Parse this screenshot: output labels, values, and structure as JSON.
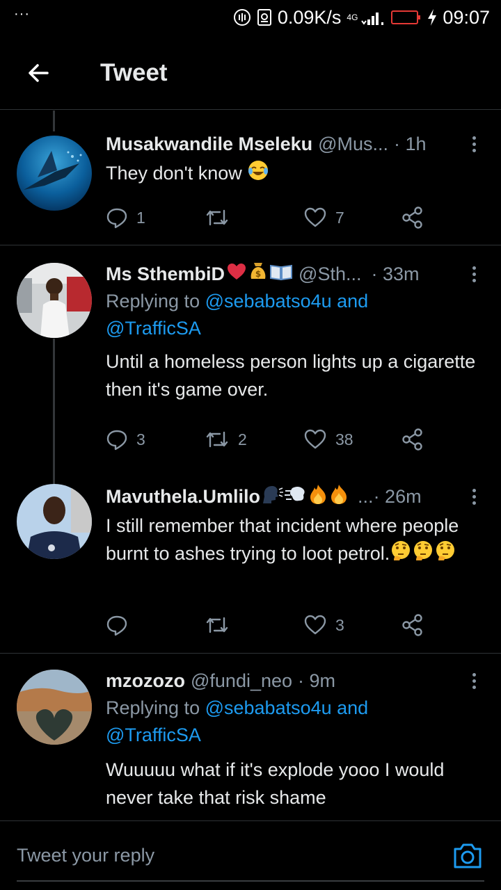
{
  "status_bar": {
    "left_dots": "···",
    "net_speed": "0.09K/s",
    "net_type": "4G",
    "time": "09:07"
  },
  "top_bar": {
    "title": "Tweet"
  },
  "tweets": [
    {
      "name": "Musakwandile Mseleku",
      "handle": "@Mus...",
      "time": "· 1h",
      "replying": null,
      "text": "They don't know ",
      "emojis": [
        "face-with-tears-of-joy"
      ],
      "reply_count": "1",
      "retweet_count": "",
      "like_count": "7"
    },
    {
      "name": "Ms SthembiD",
      "name_emojis": [
        "red-heart",
        "money-bag",
        "open-book"
      ],
      "handle": "@Sth...",
      "time": "· 33m",
      "replying_prefix": "Replying to ",
      "replying_user1": "@sebabatso4u",
      "replying_and": " and",
      "replying_user2": "@TrafficSA",
      "text": "Until a homeless person lights up a cigarette then it's game over.",
      "reply_count": "3",
      "retweet_count": "2",
      "like_count": "38"
    },
    {
      "name": "Mavuthela.Umlilo",
      "name_emojis": [
        "speaking-head",
        "dashing-away",
        "fire",
        "fire"
      ],
      "handle": "...",
      "time": "· 26m",
      "text": "I still remember that incident where people burnt to ashes trying to loot petrol.",
      "emojis": [
        "thinking-face",
        "thinking-face",
        "thinking-face"
      ],
      "reply_count": "",
      "retweet_count": "",
      "like_count": "3"
    },
    {
      "name": "mzozozo",
      "handle": "@fundi_neo",
      "time": "· 9m",
      "replying_prefix": "Replying to ",
      "replying_user1": "@sebabatso4u",
      "replying_and": " and",
      "replying_user2": "@TrafficSA",
      "text": "Wuuuuu what if it's explode yooo I would never take that risk shame"
    }
  ],
  "compose": {
    "placeholder": "Tweet your reply"
  },
  "colors": {
    "background": "#000000",
    "text": "#e7e9ea",
    "secondary": "#8b98a5",
    "accent": "#1d9bf0",
    "divider": "#2f3336"
  }
}
